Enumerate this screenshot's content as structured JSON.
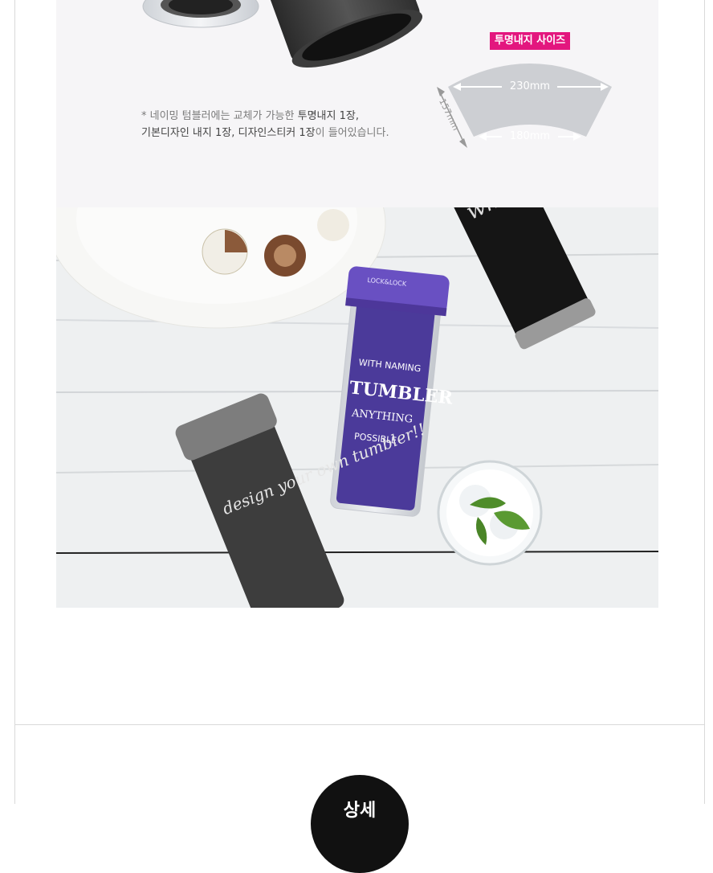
{
  "spec": {
    "badge": "투명내지 사이즈",
    "top_width": "230mm",
    "bottom_width": "180mm",
    "height": "157mm"
  },
  "notice": {
    "prefix": "* 네이밍 텀블러에는 교체가 가능한 ",
    "bold1": "투명내지 1장,",
    "line2_bold_a": "기본디자인 내지 1장, 디자인스티커 1장",
    "line2_tail": "이 들어있습니다."
  },
  "bottle_texts": {
    "purple_brand": "LOCK&LOCK",
    "purple_line1": "WITH NAMING",
    "purple_line2": "TUMBLER",
    "purple_line3": "ANYTHING",
    "purple_line4": "POSSIBLE",
    "black_bottle_text": "what's your name?",
    "gray_bottle_text": "design your own tumbler!!"
  },
  "section_badge": "상세"
}
